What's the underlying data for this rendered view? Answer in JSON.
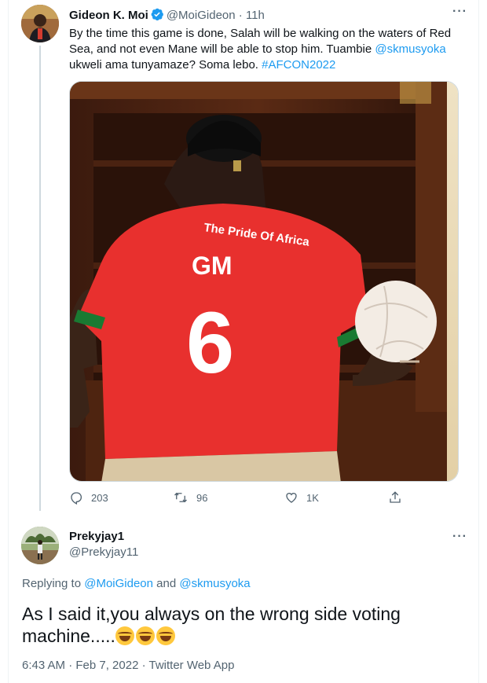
{
  "tweet": {
    "author_name": "Gideon K. Moi",
    "handle": "@MoiGideon",
    "separator": "·",
    "time": "11h",
    "text_plain_1": "By the time this game is done, Salah will be walking on the waters of Red Sea, and not even Mane will be able to stop him. Tuambie ",
    "mention": "@skmusyoka",
    "text_plain_2": " ukweli ama tunyamaze? Soma lebo. ",
    "hashtag": "#AFCON2022",
    "media": {
      "shirt_text_top": "The Pride Of Africa",
      "shirt_initials": "GM",
      "shirt_number": "6"
    },
    "actions": {
      "replies": "203",
      "retweets": "96",
      "likes": "1K"
    }
  },
  "reply": {
    "author_name": "Prekyjay1",
    "handle": "@Prekyjay11",
    "replying_prefix": "Replying to ",
    "replying_to_1": "@MoiGideon",
    "replying_and": " and ",
    "replying_to_2": "@skmusyoka",
    "text": "As I said it,you always on the wrong side voting machine.....",
    "timestamp": "6:43 AM · Feb 7, 2022 · Twitter Web App"
  },
  "icons": [
    "verified-badge-icon",
    "more-icon",
    "reply-icon",
    "retweet-icon",
    "like-icon",
    "share-icon",
    "rofl-emoji-icon"
  ],
  "colors": {
    "link": "#1d9bf0",
    "secondary_text": "#536471",
    "shirt_red": "#e8302e"
  }
}
